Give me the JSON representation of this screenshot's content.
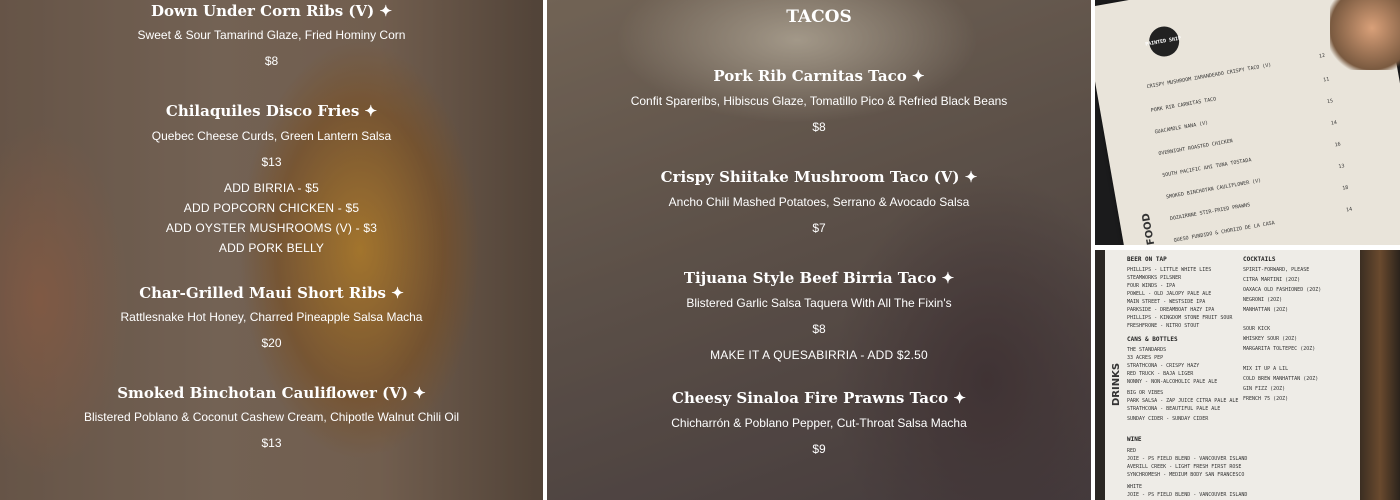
{
  "panel1": {
    "items": [
      {
        "title": "Down Under Corn Ribs (V) ✦",
        "desc": "Sweet & Sour Tamarind Glaze, Fried Hominy Corn",
        "price": "$8"
      },
      {
        "title": "Chilaquiles Disco Fries ✦",
        "desc": "Quebec Cheese Curds, Green Lantern Salsa",
        "price": "$13"
      },
      {
        "title": "Char-Grilled Maui Short Ribs ✦",
        "desc": "Rattlesnake Hot Honey, Charred Pineapple Salsa Macha",
        "price": "$20"
      },
      {
        "title": "Smoked Binchotan Cauliflower (V) ✦",
        "desc": "Blistered Poblano & Coconut Cashew Cream, Chipotle Walnut Chili Oil",
        "price": "$13"
      }
    ],
    "addons": [
      "ADD BIRRIA - $5",
      "ADD POPCORN CHICKEN - $5",
      "ADD OYSTER MUSHROOMS (V) - $3",
      "ADD PORK BELLY"
    ]
  },
  "panel2": {
    "section": "TACOS",
    "items": [
      {
        "title": "Pork Rib Carnitas Taco ✦",
        "desc": "Confit Spareribs, Hibiscus Glaze, Tomatillo Pico & Refried Black Beans",
        "price": "$8"
      },
      {
        "title": "Crispy Shiitake Mushroom Taco (V) ✦",
        "desc": "Ancho Chili Mashed Potatoes, Serrano & Avocado Salsa",
        "price": "$7"
      },
      {
        "title": "Tijuana Style Beef Birria Taco ✦",
        "desc": "Blistered Garlic Salsa Taquera With All The Fixin's",
        "price": "$8"
      },
      {
        "title": "Cheesy Sinaloa Fire Prawns Taco ✦",
        "desc": "Chicharrón & Poblano Pepper, Cut-Throat Salsa Macha",
        "price": "$9"
      }
    ],
    "addon": "MAKE IT A QUESABIRRIA - ADD $2.50"
  },
  "photo_food": {
    "logo": "PAINTED SHIP",
    "side": "FOOD",
    "lines": [
      "CRISPY MUSHROOM ZARANDEADO CRISPY TACO (V)",
      "PORK RIB CARNITAS TACO",
      "GUACAMOLE NANA (V)",
      "OVERNIGHT ROASTED CHICKEN",
      "SOUTH PACIFIC AHI TUNA TOSTADA",
      "SMOKED BINCHOTAN CAULIFLOWER (V)",
      "DOZAIRNNE STIR-FRIED PRAWNS",
      "QUESO FUNDIDO & CHORIZO DE LA CASA"
    ],
    "prices": [
      "12",
      "11",
      "15",
      "14",
      "16",
      "13",
      "18",
      "14"
    ]
  },
  "photo_drinks": {
    "side": "DRINKS",
    "beer_heading": "BEER ON TAP",
    "beer_lines": [
      "PHILLIPS - LITTLE WHITE LIES",
      "STEAMWORKS PILSNER",
      "FOUR WINDS - IPA",
      "POWELL - OLD JALOPY PALE ALE",
      "MAIN STREET - WESTSIDE IPA",
      "PARKSIDE - DREAMBOAT HAZY IPA",
      "PHILLIPS - KINGDOM STONE FRUIT SOUR",
      "FRESHFRONE - NITRO STOUT"
    ],
    "cans_heading": "CANS & BOTTLES",
    "cans_lines": [
      "THE STANDARDS",
      "33 ACRES PEP",
      "STRATHCONA - CRISPY HAZY",
      "RED TRUCK - BAJA LIGER",
      "NONNY - NON-ALCOHOLIC PALE ALE",
      "BIG OR VIBES",
      "PARK SALSA - ZAP JUICE CITRA PALE ALE",
      "STRATHCONA - BEAUTIFUL PALE ALE",
      "SUNDAY CIDER - SUNDAY CIDER"
    ],
    "wine_heading": "WINE",
    "wine_lines": [
      "RED",
      "JOIE - PS FIELD BLEND - VANCOUVER ISLAND",
      "AVERILL CREEK - LIGHT FRESH FIRST ROSE",
      "SYNCHROMESH - MEDIUM BODY SAN FRANCESCO",
      "WHITE",
      "JOIE - PS FIELD BLEND - VANCOUVER ISLAND"
    ],
    "cocktail_heading": "COCKTAILS",
    "cocktail_lines": [
      "SPIRIT-FORWARD, PLEASE",
      "CITRA MARTINI (2OZ)",
      "OAXACA OLD FASHIONED (2OZ)",
      "NEGRONI (2OZ)",
      "MANHATTAN (2OZ)",
      "SOUR KICK",
      "WHISKEY SOUR (2OZ)",
      "MARGARITA TOLTEPEC (2OZ)",
      "MIX IT UP A LIL",
      "COLD BREW MANHATTAN (2OZ)",
      "GIN FIZZ (2OZ)",
      "FRENCH 75 (2OZ)"
    ]
  }
}
